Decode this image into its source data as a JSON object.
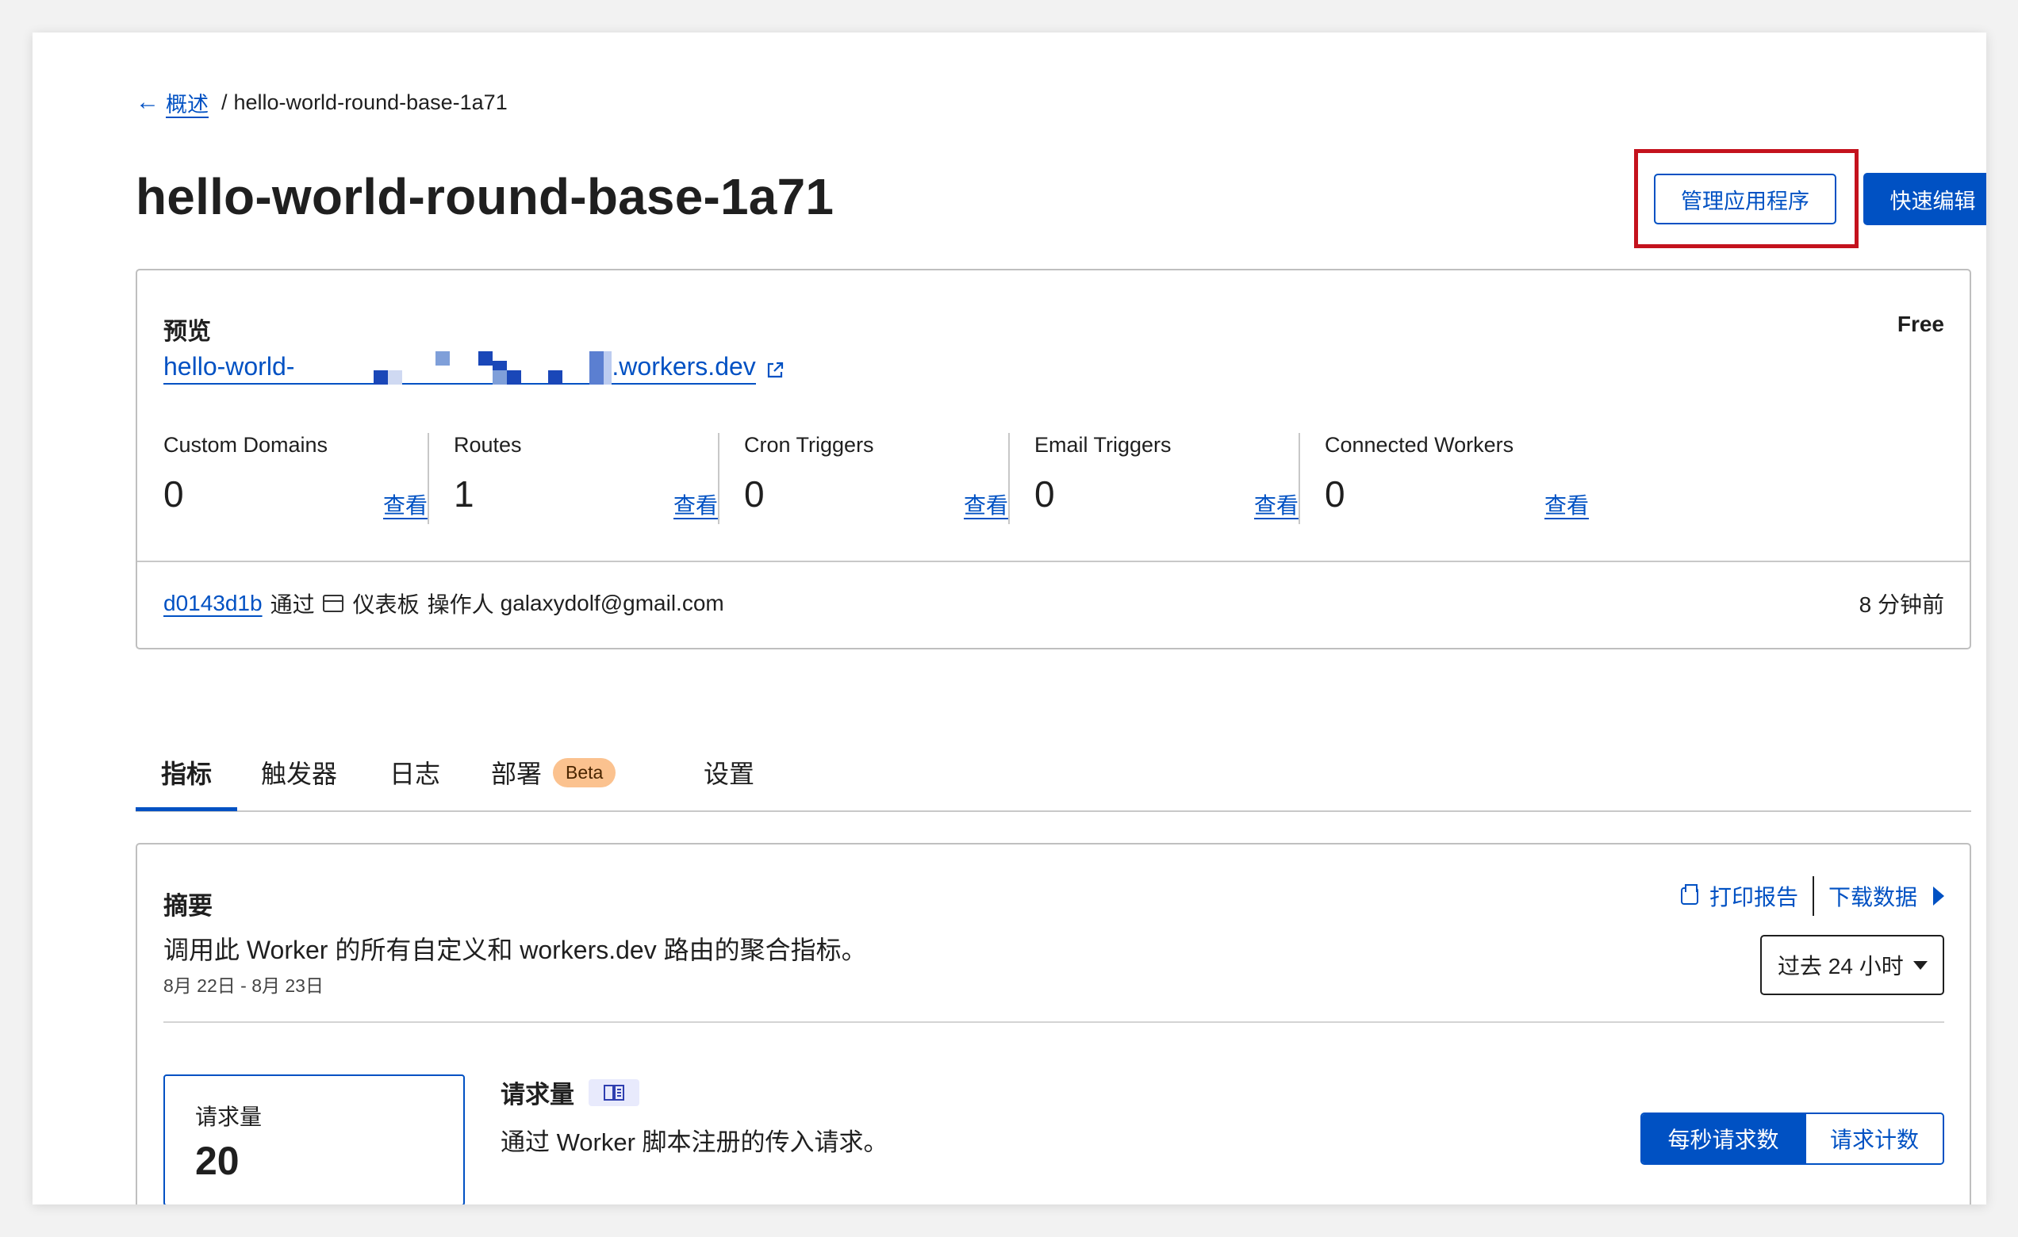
{
  "breadcrumb": {
    "back_label": "概述",
    "separator": "/",
    "current": "hello-world-round-base-1a71"
  },
  "header": {
    "title": "hello-world-round-base-1a71",
    "manage_button": "管理应用程序",
    "quick_edit_button": "快速编辑"
  },
  "overview": {
    "preview_label": "预览",
    "plan": "Free",
    "preview_url_prefix": "hello-world-",
    "preview_url_suffix": ".workers.dev",
    "stats": [
      {
        "label": "Custom Domains",
        "value": "0",
        "link": "查看"
      },
      {
        "label": "Routes",
        "value": "1",
        "link": "查看"
      },
      {
        "label": "Cron Triggers",
        "value": "0",
        "link": "查看"
      },
      {
        "label": "Email Triggers",
        "value": "0",
        "link": "查看"
      },
      {
        "label": "Connected Workers",
        "value": "0",
        "link": "查看"
      }
    ],
    "deployment": {
      "commit": "d0143d1b",
      "via": "通过",
      "source": "仪表板",
      "operator_label": "操作人",
      "operator": "galaxydolf@gmail.com",
      "time_ago": "8 分钟前"
    }
  },
  "tabs": [
    {
      "label": "指标",
      "active": true
    },
    {
      "label": "触发器",
      "active": false
    },
    {
      "label": "日志",
      "active": false
    },
    {
      "label": "部署",
      "badge": "Beta",
      "active": false
    },
    {
      "label": "设置",
      "active": false
    }
  ],
  "summary": {
    "title": "摘要",
    "description": "调用此 Worker 的所有自定义和 workers.dev 路由的聚合指标。",
    "date_range": "8月 22日 - 8月 23日",
    "print_label": "打印报告",
    "download_label": "下载数据",
    "time_select": "过去 24 小时",
    "metric_card": {
      "label": "请求量",
      "value": "20"
    },
    "requests": {
      "title": "请求量",
      "description": "通过 Worker 脚本注册的传入请求。",
      "toggle_on": "每秒请求数",
      "toggle_off": "请求计数"
    }
  },
  "colors": {
    "accent": "#0051c3",
    "highlight": "#c4121d",
    "beta_badge": "#fbc28f"
  },
  "icons": [
    "back-arrow-icon",
    "external-link-icon",
    "dashboard-icon",
    "print-icon",
    "caret-right-icon",
    "chevron-down-icon",
    "docs-icon"
  ]
}
